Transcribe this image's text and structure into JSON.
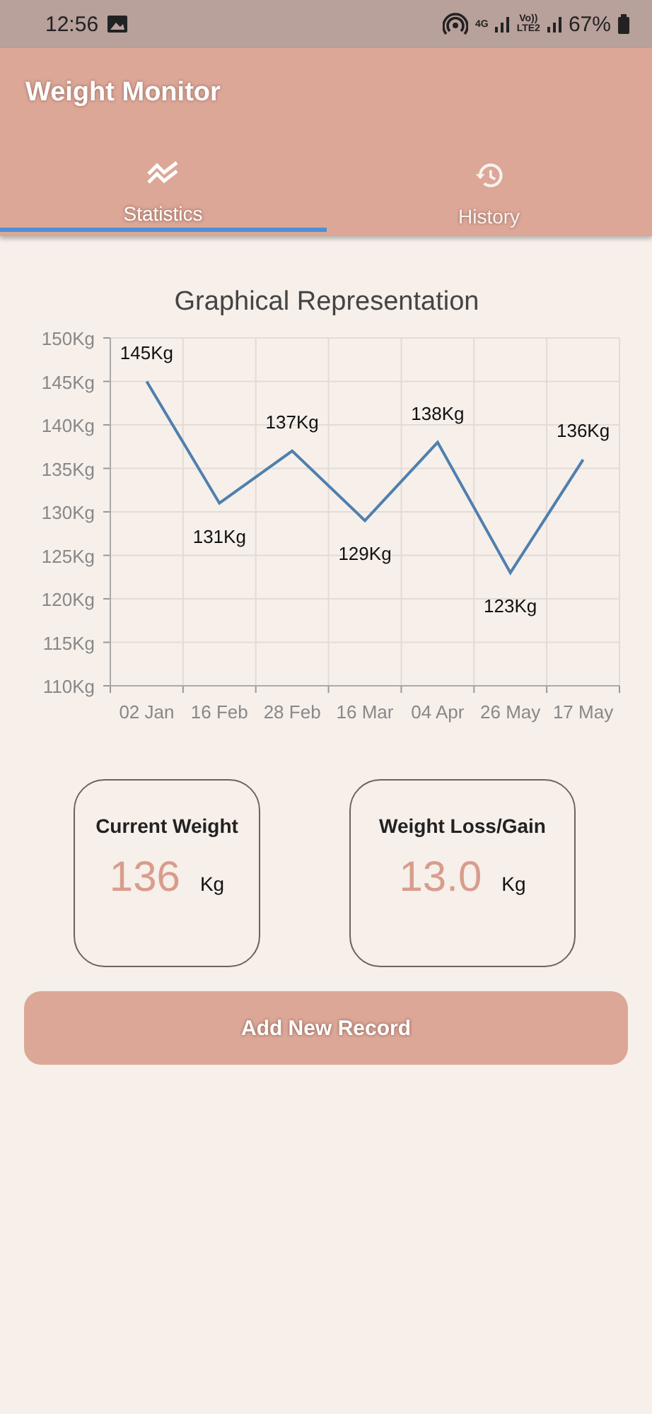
{
  "status_bar": {
    "time": "12:56",
    "network_1": "4G",
    "network_2_top": "Vo))",
    "network_2_bottom": "LTE2",
    "battery": "67%"
  },
  "app_bar": {
    "title": "Weight Monitor"
  },
  "tabs": [
    {
      "label": "Statistics",
      "selected": true,
      "kind": "chart"
    },
    {
      "label": "History",
      "selected": false,
      "kind": "history"
    }
  ],
  "chart": {
    "chart_data": {
      "type": "line",
      "title": "Graphical Representation",
      "categories": [
        "02 Jan",
        "16 Feb",
        "28 Feb",
        "16 Mar",
        "04 Apr",
        "26 May",
        "17 May"
      ],
      "grid": true,
      "series": [
        {
          "color": "#4f7fae",
          "values": [
            145,
            131,
            137,
            129,
            138,
            123,
            136
          ]
        }
      ],
      "ylim": [
        110,
        150
      ],
      "yticks": [
        {
          "value": 110,
          "label": "110Kg"
        },
        {
          "value": 115,
          "label": "115Kg"
        },
        {
          "value": 120,
          "label": "120Kg"
        },
        {
          "value": 125,
          "label": "125Kg"
        },
        {
          "value": 130,
          "label": "130Kg"
        },
        {
          "value": 135,
          "label": "135Kg"
        },
        {
          "value": 140,
          "label": "140Kg"
        },
        {
          "value": 145,
          "label": "145Kg"
        },
        {
          "value": 150,
          "label": "150Kg"
        }
      ],
      "value_labels": [
        "145Kg",
        "131Kg",
        "137Kg",
        "129Kg",
        "138Kg",
        "123Kg",
        "136Kg"
      ]
    }
  },
  "cards": [
    {
      "title": "Current Weight",
      "value": "136",
      "unit": "Kg"
    },
    {
      "title": "Weight Loss/Gain",
      "value": "13.0",
      "unit": "Kg"
    }
  ],
  "add_button": {
    "label": "Add New Record"
  }
}
